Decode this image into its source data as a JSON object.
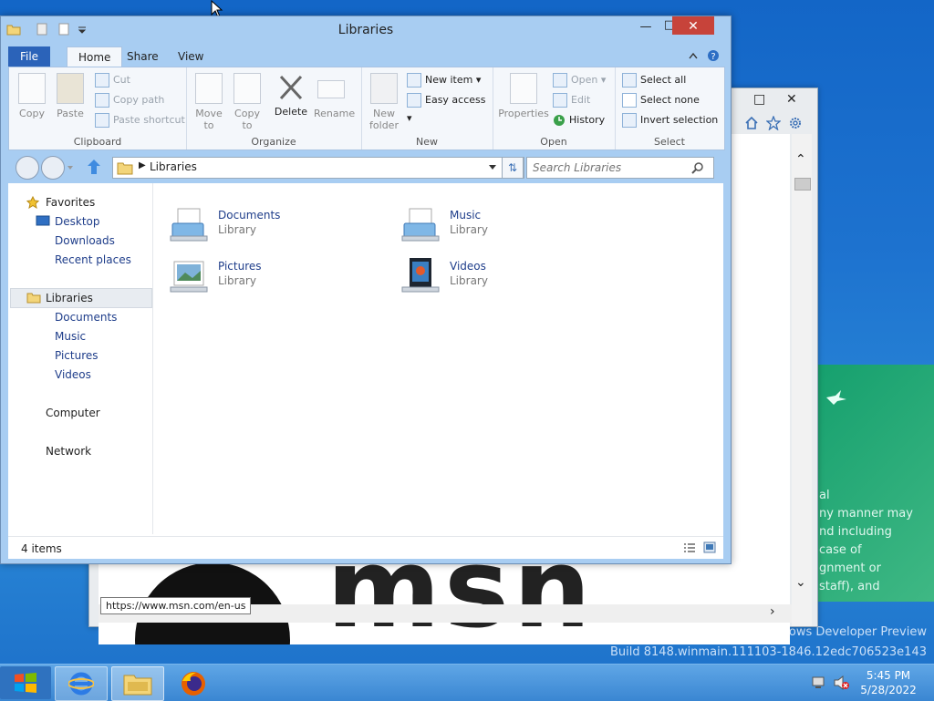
{
  "desktop": {
    "watermark_line1": "Windows Developer Preview",
    "watermark_line2": "Build 8148.winmain.111103-1846.12edc706523e143"
  },
  "ie_window": {
    "status_url": "https://www.msn.com/en-us",
    "logo_text": "msn",
    "side_text": "al\nny manner may\nnd including\ncase of\ngnment or\nstaff), and"
  },
  "explorer": {
    "title": "Libraries",
    "tabs": [
      "File",
      "Home",
      "Share",
      "View"
    ],
    "ribbon": {
      "clipboard": {
        "label": "Clipboard",
        "copy": "Copy",
        "paste": "Paste",
        "cut": "Cut",
        "copy_path": "Copy path",
        "paste_shortcut": "Paste shortcut"
      },
      "organize": {
        "label": "Organize",
        "move_to": "Move to",
        "copy_to": "Copy to",
        "delete": "Delete",
        "rename": "Rename"
      },
      "new": {
        "label": "New",
        "new_folder": "New folder",
        "new_item": "New item",
        "easy_access": "Easy access"
      },
      "open": {
        "label": "Open",
        "properties": "Properties",
        "open": "Open",
        "edit": "Edit",
        "history": "History"
      },
      "select": {
        "label": "Select",
        "select_all": "Select all",
        "select_none": "Select none",
        "invert_selection": "Invert selection"
      }
    },
    "address": {
      "path": "Libraries",
      "search_placeholder": "Search Libraries"
    },
    "nav": {
      "favorites": "Favorites",
      "desktop": "Desktop",
      "downloads": "Downloads",
      "recent": "Recent places",
      "libraries": "Libraries",
      "documents": "Documents",
      "music": "Music",
      "pictures": "Pictures",
      "videos": "Videos",
      "computer": "Computer",
      "network": "Network"
    },
    "items": [
      {
        "name": "Documents",
        "type": "Library"
      },
      {
        "name": "Music",
        "type": "Library"
      },
      {
        "name": "Pictures",
        "type": "Library"
      },
      {
        "name": "Videos",
        "type": "Library"
      }
    ],
    "status": "4 items"
  },
  "taskbar": {
    "time": "5:45 PM",
    "date": "5/28/2022"
  },
  "colors": {
    "desktop": "#1d72cf",
    "file_tab": "#2b63b9",
    "close_button": "#c7433a",
    "taskbar": "#4a95dc"
  }
}
